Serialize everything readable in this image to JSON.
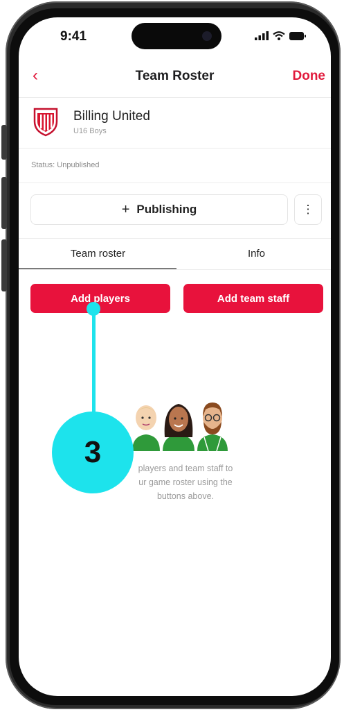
{
  "status_bar": {
    "time": "9:41"
  },
  "nav": {
    "back_icon": "chevron-left-icon",
    "title": "Team Roster",
    "done_label": "Done"
  },
  "team": {
    "name": "Billing United",
    "subtitle": "U16 Boys",
    "status": "Status: Unpublished"
  },
  "actions": {
    "publishing_label": "Publishing",
    "publishing_prefix": "+",
    "more_icon": "vertical-ellipsis-icon",
    "more_glyph": "⋮"
  },
  "tabs": [
    {
      "label": "Team roster",
      "active": true
    },
    {
      "label": "Info",
      "active": false
    }
  ],
  "buttons": {
    "add_players": "Add players",
    "add_staff": "Add team staff"
  },
  "empty_state": {
    "line1": "players and team staff to",
    "line2": "ur game roster using the",
    "line3": "buttons above."
  },
  "callout": {
    "number": "3"
  },
  "colors": {
    "accent": "#e8123c",
    "callout": "#1de3ec",
    "shirt": "#2f9a3a"
  }
}
